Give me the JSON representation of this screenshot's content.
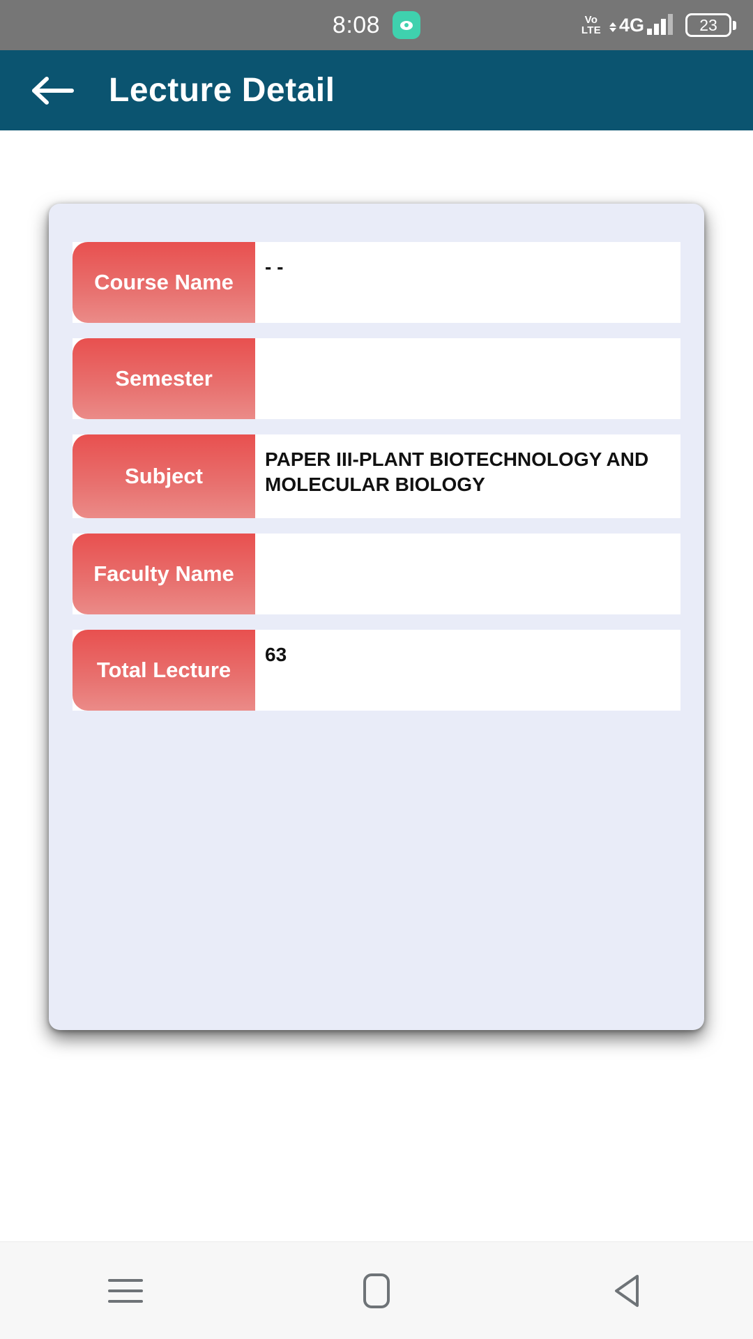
{
  "status_bar": {
    "time": "8:08",
    "app_icon": "camera-notification-icon",
    "volte_line1": "Vo",
    "volte_line2": "LTE",
    "network_type": "4G",
    "battery_level": "23"
  },
  "app_bar": {
    "back_icon": "arrow-left-icon",
    "title": "Lecture Detail"
  },
  "detail_card": {
    "rows": [
      {
        "label": "Course Name",
        "value": "- -"
      },
      {
        "label": "Semester",
        "value": ""
      },
      {
        "label": "Subject",
        "value": "PAPER III-PLANT BIOTECHNOLOGY AND MOLECULAR BIOLOGY"
      },
      {
        "label": "Faculty Name",
        "value": ""
      },
      {
        "label": "Total Lecture",
        "value": "63"
      }
    ]
  },
  "nav_bar": {
    "recents_icon": "menu-recents-icon",
    "home_icon": "home-square-icon",
    "back_icon": "back-triangle-icon"
  },
  "colors": {
    "app_bar": "#0b5470",
    "status_bar": "#767676",
    "card_bg": "#e9ecf8",
    "label_chip": "#e8504f",
    "app_icon": "#3fd1ae"
  }
}
